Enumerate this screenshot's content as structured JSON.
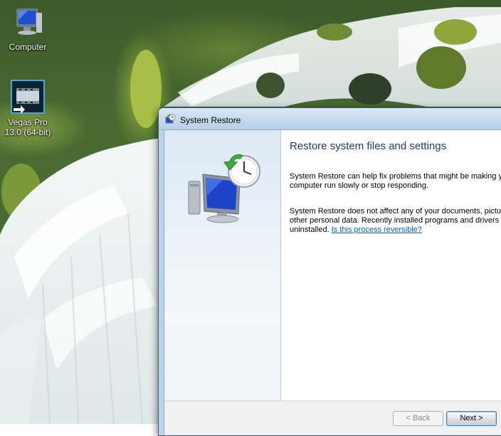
{
  "desktop": {
    "icons": [
      {
        "label": "Computer",
        "icon": "computer-icon"
      },
      {
        "label": "Vegas Pro 13.0 (64-bit)",
        "icon": "vegas-pro-icon"
      }
    ]
  },
  "window": {
    "title": "System Restore",
    "app_icon": "system-restore-icon",
    "heading": "Restore system files and settings",
    "para1": "System Restore can help fix problems that might be making yo\ncomputer run slowly or stop responding.",
    "para2_text": "System Restore does not affect any of your documents, pictur\nother personal data. Recently installed programs and drivers m\nuninstalled. ",
    "para2_link": "Is this process reversible?",
    "buttons": {
      "back": "< Back",
      "next": "Next >"
    }
  },
  "colors": {
    "accent": "#0a5bb6",
    "heading": "#1e3a5f",
    "titlebar": "#c6d9ee"
  }
}
